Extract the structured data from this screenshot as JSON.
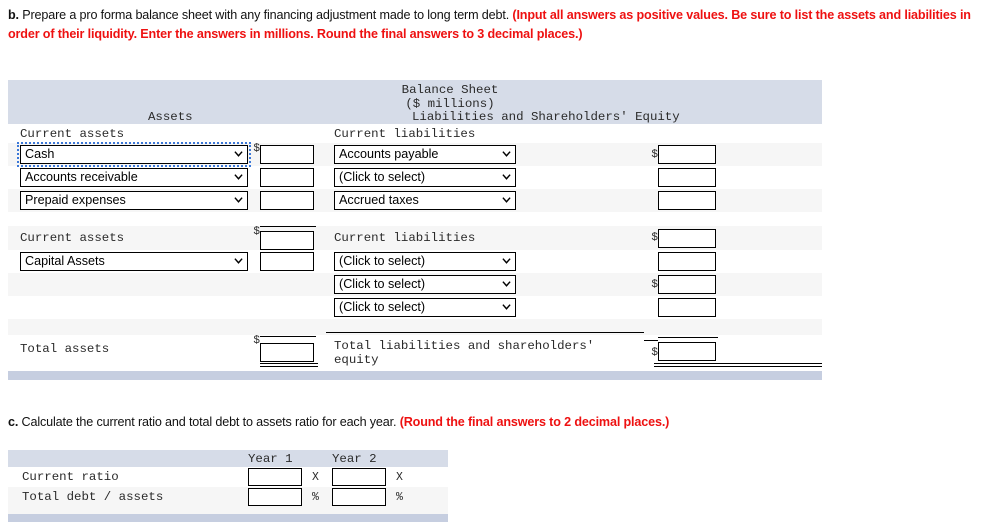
{
  "prompts": {
    "b": {
      "lead": "b.",
      "text": " Prepare a pro forma balance sheet with any financing adjustment made to long term debt. ",
      "red": "(Input all answers as positive values. Be sure to list the assets and liabilities in order of their liquidity. Enter the answers in millions. Round the final answers to 3 decimal places.)"
    },
    "c": {
      "lead": "c.",
      "text": " Calculate the current ratio and total debt to assets ratio for each year. ",
      "red": "(Round the final answers to 2 decimal places.)"
    }
  },
  "balance_sheet": {
    "title": "Balance Sheet",
    "subtitle": "($ millions)",
    "assets_header": "Assets",
    "liabilities_header": "Liabilities and Shareholders' Equity",
    "dollar_sign": "$",
    "left": {
      "section_1_label": "Current assets",
      "rows": [
        {
          "select": "Cash",
          "focused": true,
          "value": ""
        },
        {
          "select": "Accounts receivable",
          "focused": false,
          "value": ""
        },
        {
          "select": "Prepaid expenses",
          "focused": false,
          "value": ""
        }
      ],
      "subtotal_label": "Current assets",
      "subtotal_value": "",
      "capital_row": {
        "select": "Capital Assets",
        "value": ""
      },
      "total_label": "Total assets",
      "total_value": ""
    },
    "right": {
      "section_1_label": "Current liabilities",
      "rows": [
        {
          "select": "Accounts payable",
          "value": "",
          "dollar": true
        },
        {
          "select": "(Click to select)",
          "value": "",
          "dollar": false
        },
        {
          "select": "Accrued taxes",
          "value": "",
          "dollar": false
        }
      ],
      "subtotal_label": "Current liabilities",
      "subtotal_value": "",
      "lower_rows": [
        {
          "select": "(Click to select)",
          "value": "",
          "dollar": false
        },
        {
          "select": "(Click to select)",
          "value": "",
          "dollar": true
        },
        {
          "select": "(Click to select)",
          "value": "",
          "dollar": false
        }
      ],
      "total_label": "Total liabilities and shareholders' equity",
      "total_value": ""
    },
    "select_placeholder": "(Click to select)"
  },
  "ratios": {
    "col_headers": [
      "Year 1",
      "Year 2"
    ],
    "rows": [
      {
        "label": "Current ratio",
        "year1": "",
        "year2": "",
        "unit1": "X",
        "unit2": "X"
      },
      {
        "label": "Total debt / assets",
        "year1": "",
        "year2": "",
        "unit1": "%",
        "unit2": "%"
      }
    ]
  },
  "colors": {
    "header_band": "#d6dce8",
    "footer_band": "#c6cee0",
    "alt_row": "#f6f6f6",
    "red_text": "#ee1111",
    "focus_outline": "#3b78d8"
  }
}
